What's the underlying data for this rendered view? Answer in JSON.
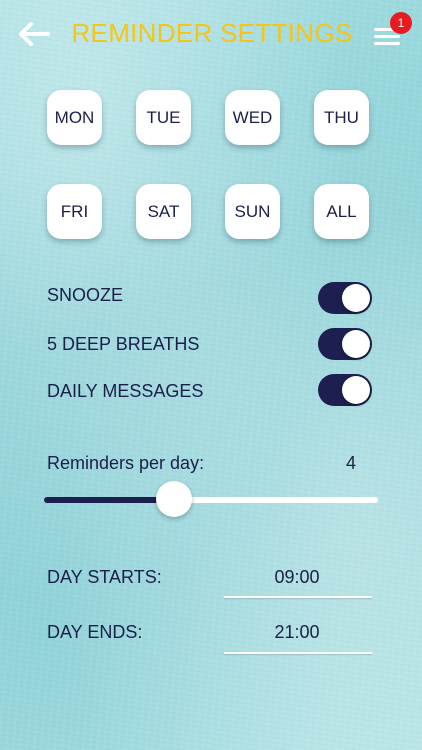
{
  "header": {
    "title": "REMINDER SETTINGS",
    "back_icon": "back-arrow-icon",
    "menu_icon": "hamburger-menu-icon",
    "badge_count": "1"
  },
  "colors": {
    "title": "#f5c518",
    "accent": "#1c1f4f",
    "badge": "#e81b23"
  },
  "days": [
    "MON",
    "TUE",
    "WED",
    "THU",
    "FRI",
    "SAT",
    "SUN",
    "ALL"
  ],
  "toggles": [
    {
      "label": "SNOOZE",
      "on": true
    },
    {
      "label": "5 DEEP BREATHS",
      "on": true
    },
    {
      "label": "DAILY MESSAGES",
      "on": true
    }
  ],
  "reminders": {
    "label": "Reminders per day:",
    "value": "4",
    "slider_fraction": 0.39
  },
  "day_start": {
    "label": "DAY STARTS:",
    "value": "09:00"
  },
  "day_end": {
    "label": "DAY ENDS:",
    "value": "21:00"
  }
}
